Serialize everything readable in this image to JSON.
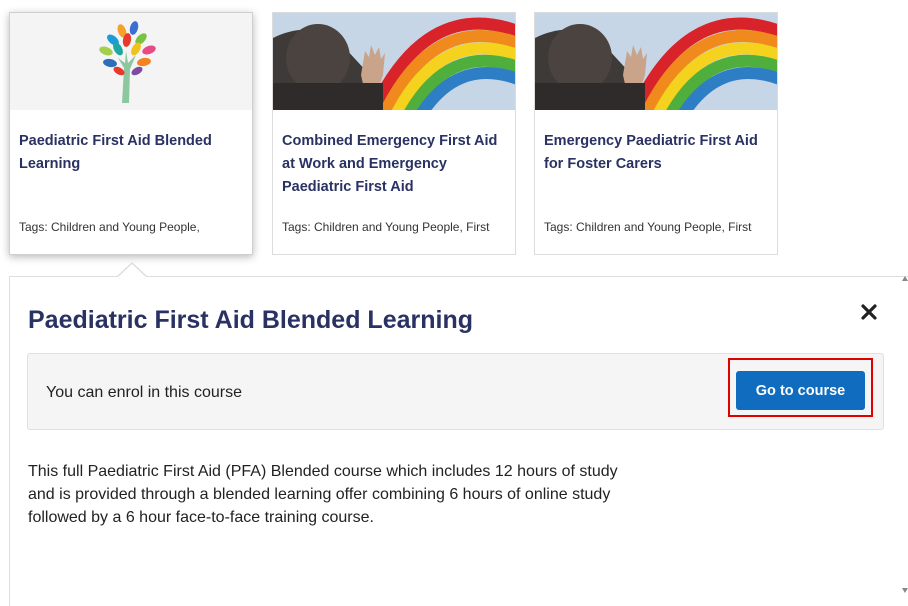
{
  "cards": [
    {
      "title": "Paediatric First Aid Blended Learning",
      "tags": "Tags: Children and Young People,",
      "image": "tree-logo-icon"
    },
    {
      "title": "Combined Emergency First Aid at Work and Emergency Paediatric First Aid",
      "tags": "Tags: Children and Young People, First",
      "image": "child-rainbow-window-image"
    },
    {
      "title": "Emergency Paediatric First Aid for Foster Carers",
      "tags": "Tags: Children and Young People, First",
      "image": "child-rainbow-window-image"
    }
  ],
  "panel": {
    "title": "Paediatric First Aid Blended Learning",
    "enrol_text": "You can enrol in this course",
    "button_label": "Go to course",
    "description": "This full Paediatric First Aid (PFA) Blended course which includes 12 hours of study and is provided through a blended learning offer combining 6 hours of online study followed by a 6 hour face-to-face training course."
  },
  "colors": {
    "title": "#2a3163",
    "button": "#0f6cbf",
    "highlight": "#e00000",
    "enrol_box": "#f5f5f5"
  },
  "icons": {
    "close": "close-x-icon"
  }
}
